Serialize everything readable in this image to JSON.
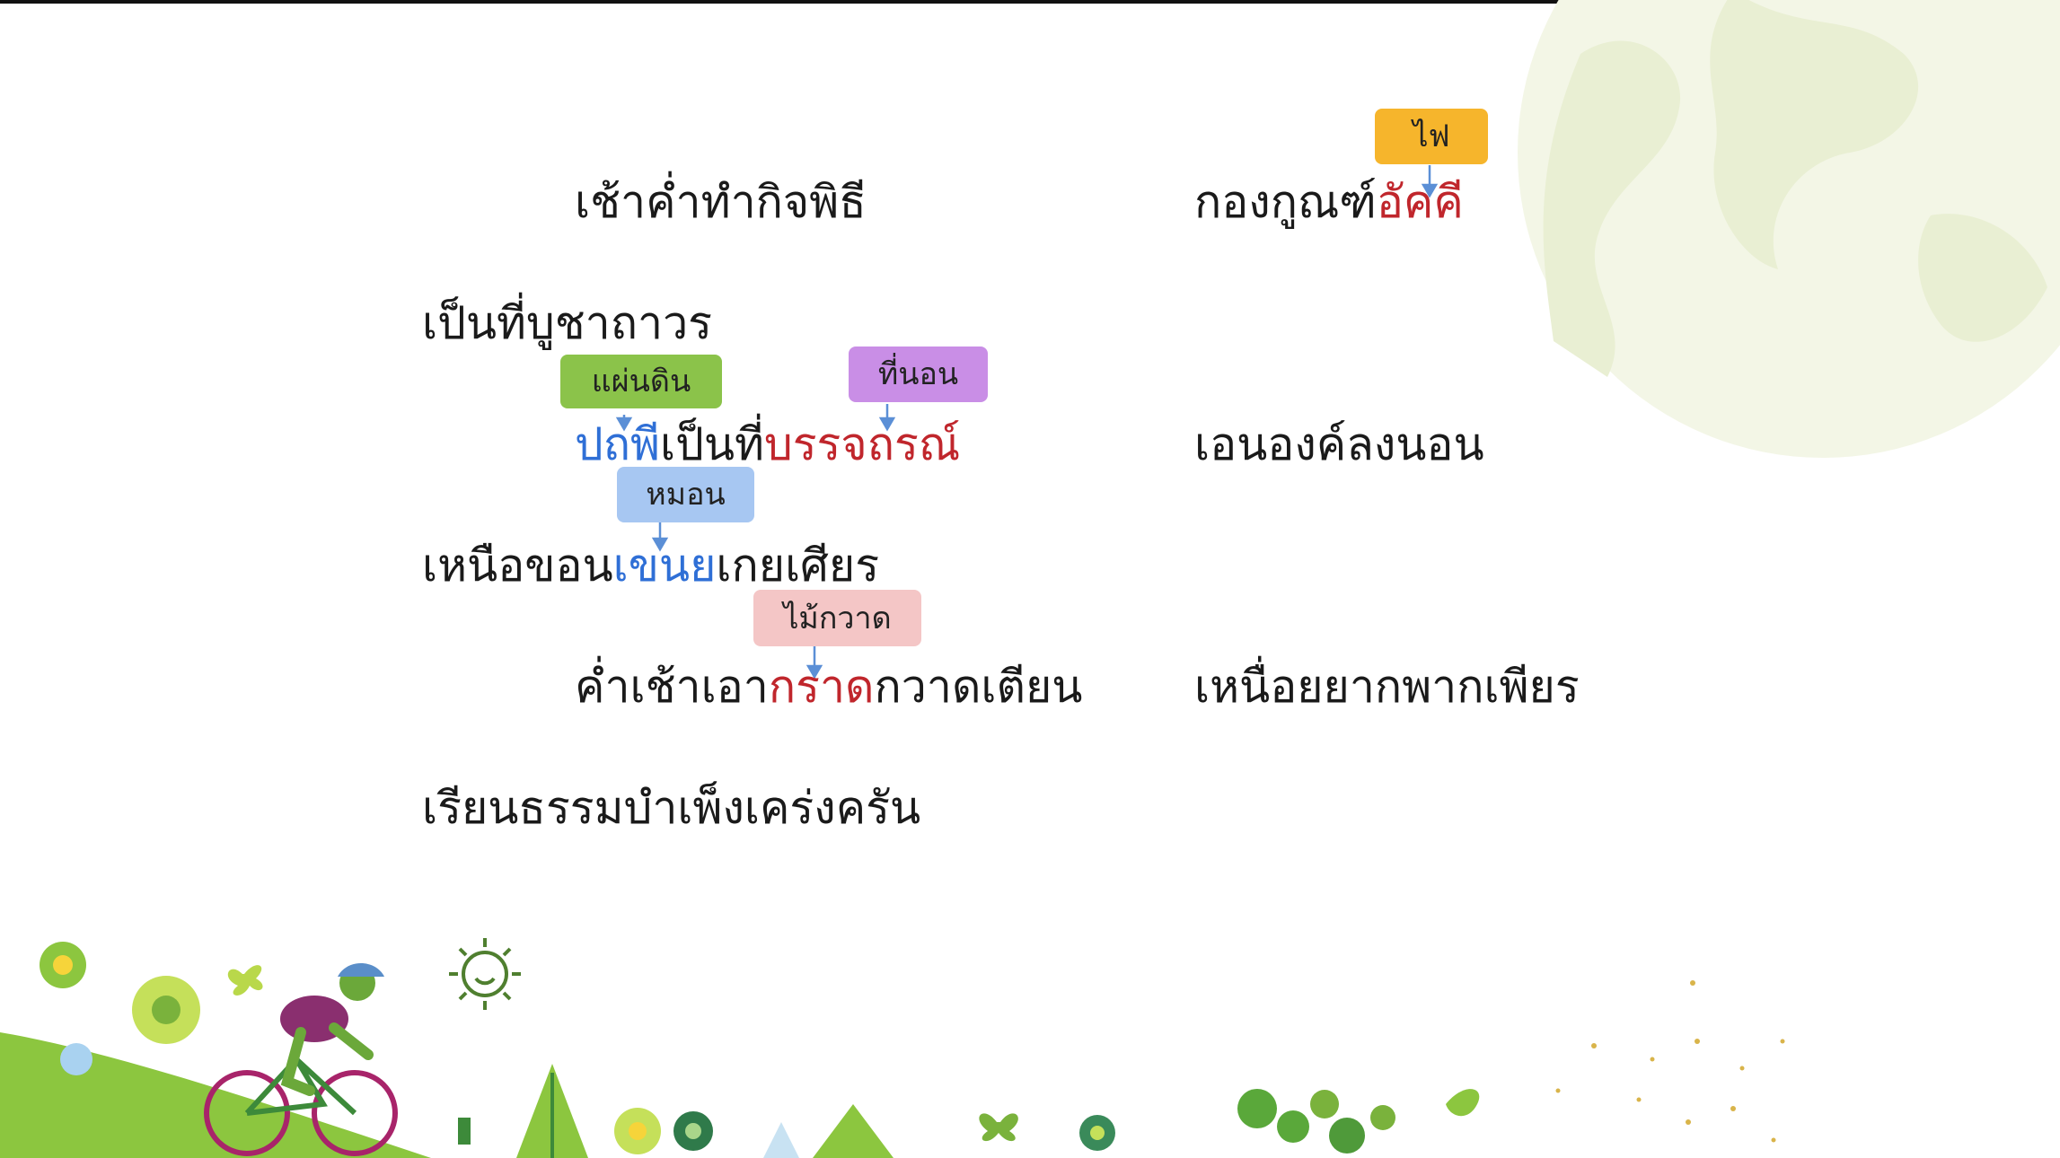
{
  "verses": {
    "l1_left": "เช้าค่ำทำกิจพิธี",
    "l1_right_a": "กองกูณฑ์",
    "l1_right_b": "อัคคี",
    "l2_left": "เป็นที่บูชาถาวร",
    "l3_left_a": "ปถพี",
    "l3_left_b": "เป็นที่",
    "l3_left_c": "บรรจถรณ์",
    "l3_right": "เอนองค์ลงนอน",
    "l4_left_a": "เหนือขอน",
    "l4_left_b": "เขนย",
    "l4_left_c": "เกยเศียร",
    "l5_left_a": "ค่ำเช้าเอา",
    "l5_left_b": "กราด",
    "l5_left_c": "กวาดเตียน",
    "l5_right": "เหนื่อยยากพากเพียร",
    "l6_left": "เรียนธรรมบำเพ็งเคร่งครัน"
  },
  "glosses": {
    "fire": "ไฟ",
    "earth": "แผ่นดิน",
    "bed": "ที่นอน",
    "pillow": "หมอน",
    "broom": "ไม้กวาด"
  },
  "colors": {
    "highlight_blue": "#2f6fd6",
    "highlight_red": "#c0262c",
    "tag_fire": "#f6b52c",
    "tag_earth": "#8bc34a",
    "tag_bed": "#c98ee6",
    "tag_pillow": "#a7c7f2",
    "tag_broom": "#f4c6c6",
    "arrow": "#5b8fd6"
  },
  "decorations": [
    "globe-watermark-icon",
    "cyclist-icon",
    "sun-icon",
    "flower-icon",
    "tree-icon",
    "butterfly-icon",
    "hill-icon"
  ]
}
